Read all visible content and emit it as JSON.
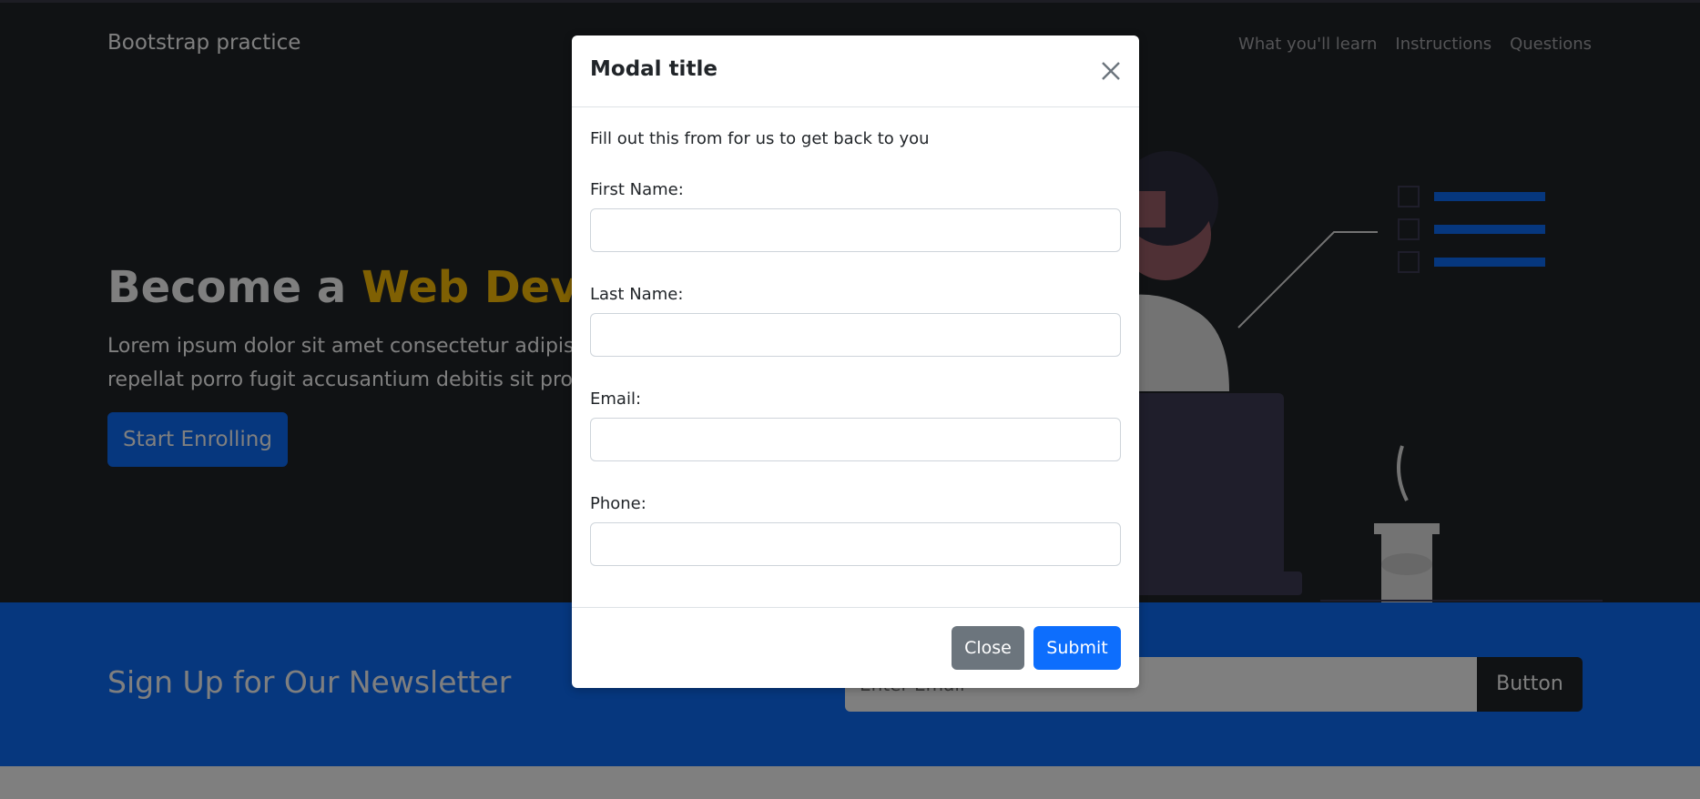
{
  "navbar": {
    "brand": "Bootstrap practice",
    "links": [
      "What you'll learn",
      "Instructions",
      "Questions"
    ]
  },
  "hero": {
    "title_prefix": "Become a ",
    "title_accent": "Web Developer",
    "lead_line1": "Lorem ipsum dolor sit amet consectetur adipisicing elit. Quo",
    "lead_line2": "repellat porro fugit accusantium debitis sit provident",
    "cta_label": "Start Enrolling"
  },
  "newsletter": {
    "title": "Sign Up for Our Newsletter",
    "email_placeholder": "Enter Email",
    "button_label": "Button"
  },
  "modal": {
    "title": "Modal title",
    "intro": "Fill out this from for us to get back to you",
    "fields": [
      {
        "label": "First Name:",
        "value": ""
      },
      {
        "label": "Last Name:",
        "value": ""
      },
      {
        "label": "Email:",
        "value": ""
      },
      {
        "label": "Phone:",
        "value": ""
      }
    ],
    "close_label": "Close",
    "submit_label": "Submit"
  },
  "colors": {
    "primary": "#0d6efd",
    "dark": "#212529",
    "accent": "#ffc107",
    "secondary": "#6c757d"
  },
  "icons": {
    "modal_close": "close-icon",
    "hero_illustration": "person-at-laptop-illustration"
  }
}
